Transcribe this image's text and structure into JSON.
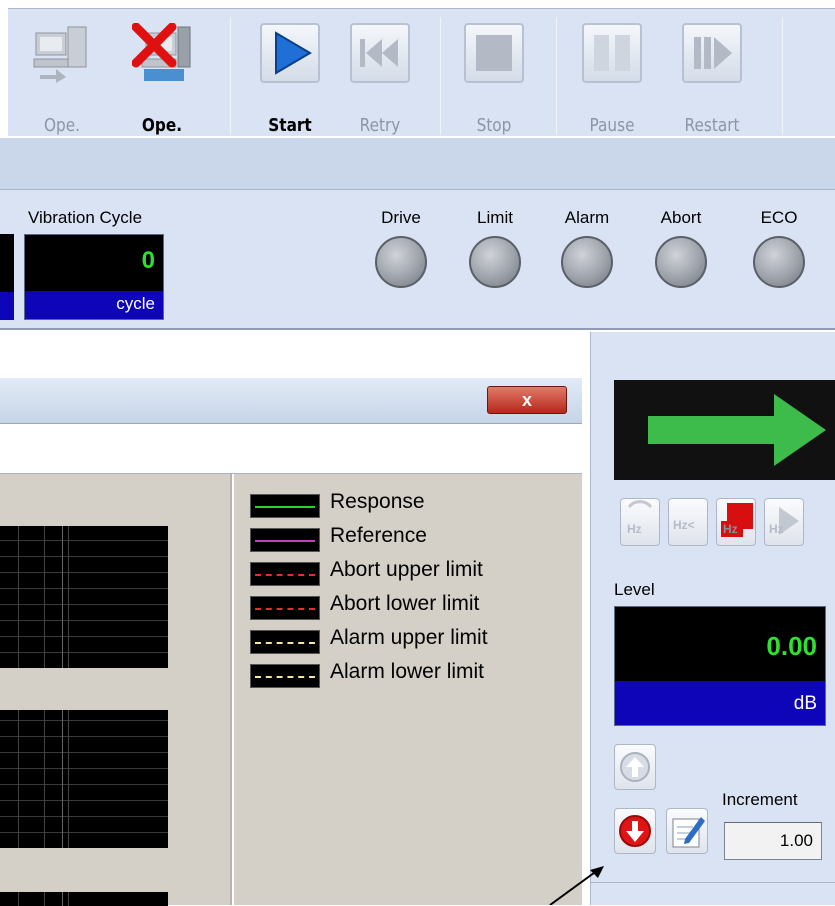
{
  "toolbar": {
    "ope_start": "Ope. start",
    "ope_end": "Ope. end",
    "start": "Start",
    "retry": "Retry",
    "stop": "Stop",
    "pause": "Pause",
    "restart": "Restart"
  },
  "status": {
    "vibration_cycle_label": "Vibration Cycle",
    "vibration_cycle_value": "0",
    "vibration_cycle_unit": "cycle",
    "leds": [
      "Drive",
      "Limit",
      "Alarm",
      "Abort",
      "ECO"
    ]
  },
  "window": {
    "close_label": "x"
  },
  "legend": [
    {
      "label": "Response",
      "color": "#30d030",
      "style": "solid"
    },
    {
      "label": "Reference",
      "color": "#c040c0",
      "style": "solid"
    },
    {
      "label": "Abort upper limit",
      "color": "#e03030",
      "style": "dashed"
    },
    {
      "label": "Abort lower limit",
      "color": "#e03030",
      "style": "dashed"
    },
    {
      "label": "Alarm upper limit",
      "color": "#f0e8a0",
      "style": "dashed"
    },
    {
      "label": "Alarm lower limit",
      "color": "#f0e8a0",
      "style": "dashed"
    }
  ],
  "level": {
    "label": "Level",
    "value": "0.00",
    "unit": "dB"
  },
  "hz_buttons": [
    "Hz",
    "Hz<",
    "Hz",
    "Hz"
  ],
  "increment": {
    "label": "Increment",
    "value": "1.00"
  },
  "colors": {
    "accent_green": "#3dbb4b",
    "led_unit_bg": "#0e05b8",
    "close_red": "#c0392b"
  }
}
